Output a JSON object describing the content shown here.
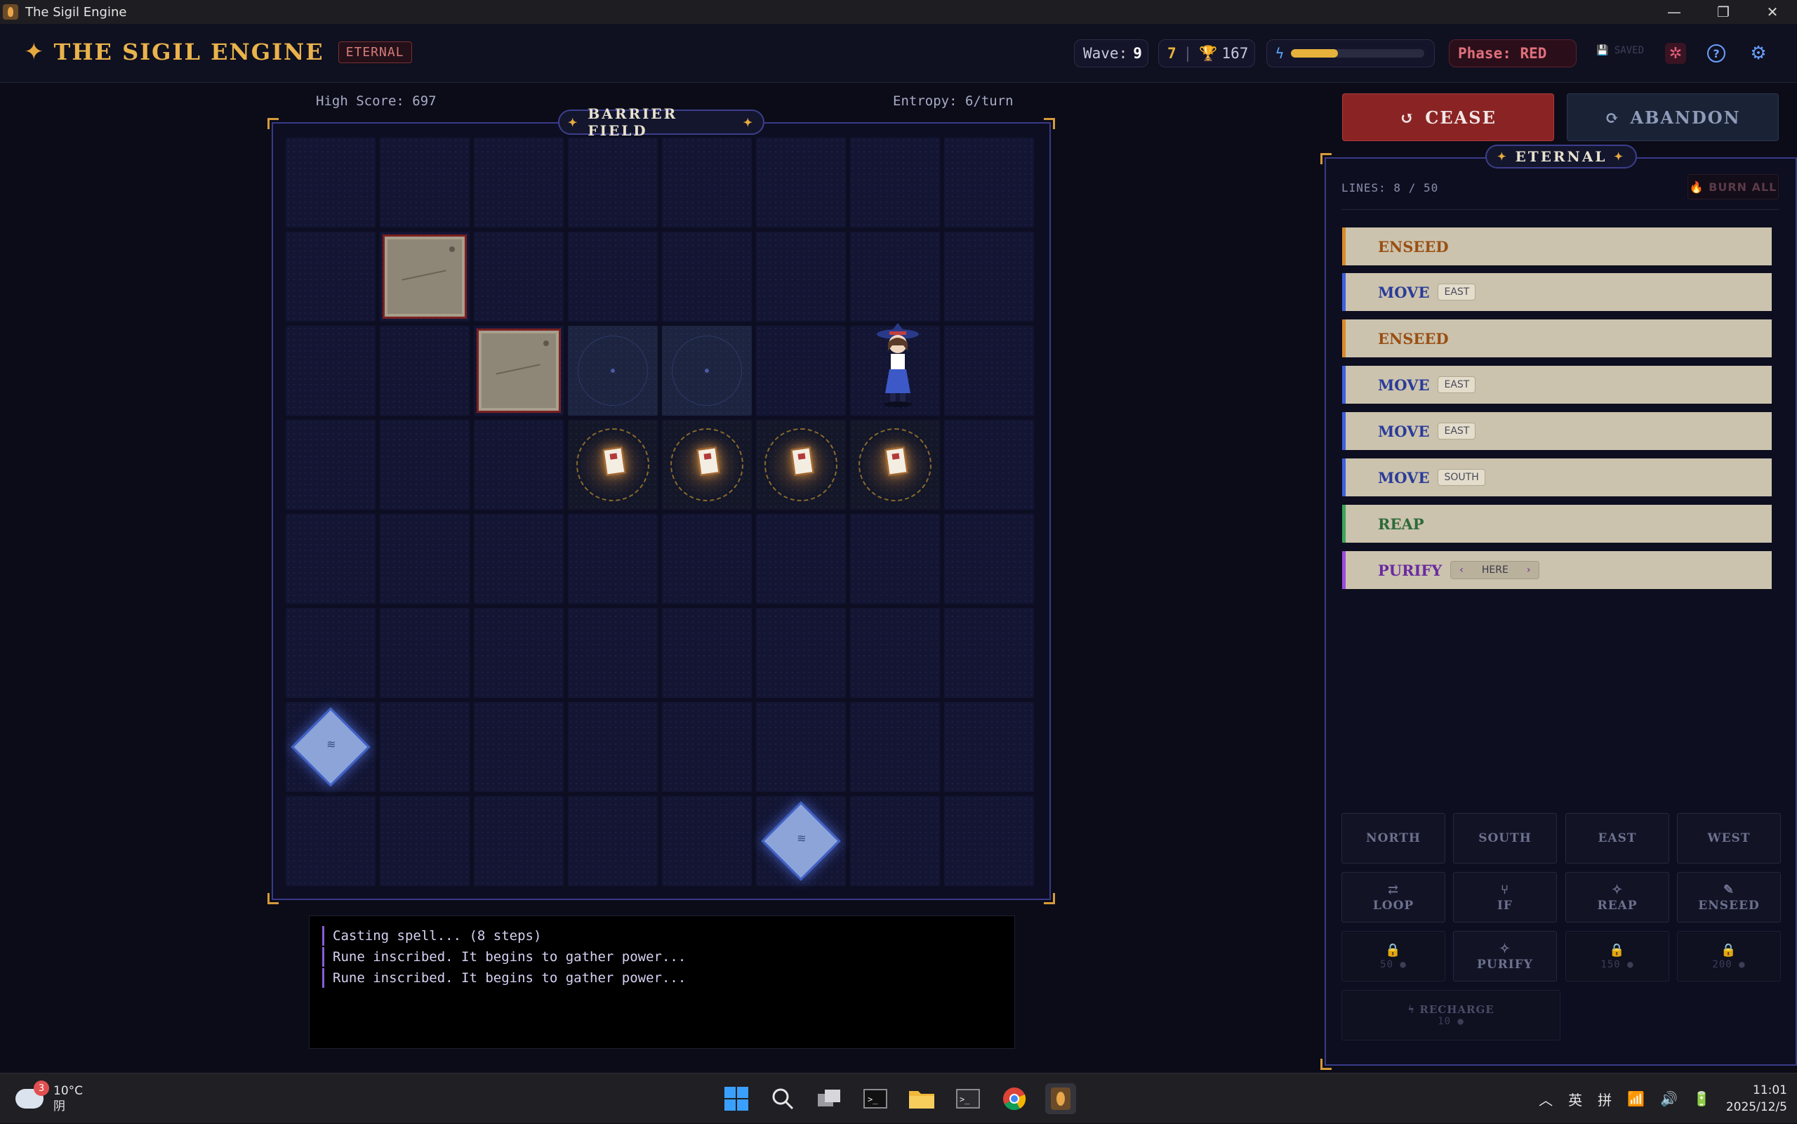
{
  "window": {
    "title": "The Sigil Engine"
  },
  "header": {
    "app_name": "THE SIGIL ENGINE",
    "mode_badge": "ETERNAL",
    "wave_label": "Wave:",
    "wave_value": "9",
    "gold": "7",
    "score_sep": "|",
    "trophies": "167",
    "energy_fraction": 0.35,
    "phase": "Phase: RED",
    "saved": "SAVED"
  },
  "board": {
    "high_score": "High Score: 697",
    "entropy": "Entropy: 6/turn",
    "label": "BARRIER FIELD",
    "label_star": "✦"
  },
  "console": {
    "lines": [
      "Casting spell... (8 steps)",
      "Rune inscribed. It begins to gather power...",
      "Rune inscribed. It begins to gather power..."
    ]
  },
  "controls": {
    "cease": "CEASE",
    "abandon": "ABANDON"
  },
  "panel": {
    "label": "ETERNAL",
    "lines_count": "LINES: 8 / 50",
    "burn_all": "BURN ALL",
    "spell": [
      {
        "cmd": "ENSEED",
        "arg": ""
      },
      {
        "cmd": "MOVE",
        "arg": "EAST"
      },
      {
        "cmd": "ENSEED",
        "arg": ""
      },
      {
        "cmd": "MOVE",
        "arg": "EAST"
      },
      {
        "cmd": "MOVE",
        "arg": "EAST"
      },
      {
        "cmd": "MOVE",
        "arg": "SOUTH"
      },
      {
        "cmd": "REAP",
        "arg": ""
      },
      {
        "cmd": "PURIFY",
        "arg": "HERE",
        "prev": "‹",
        "next": "›"
      }
    ],
    "buttons": {
      "north": "NORTH",
      "south": "SOUTH",
      "east": "EAST",
      "west": "WEST",
      "loop": "LOOP",
      "if": "IF",
      "reap": "REAP",
      "enseed": "ENSEED",
      "locked1": "50 ●",
      "purify": "PURIFY",
      "locked2": "150 ●",
      "locked3": "200 ●",
      "recharge": "RECHARGE",
      "recharge_cost": "10 ●"
    }
  },
  "taskbar": {
    "weather_badge": "3",
    "temperature": "10°C",
    "condition": "阴",
    "ime1": "英",
    "ime2": "拼",
    "time": "11:01",
    "date": "2025/12/5"
  }
}
